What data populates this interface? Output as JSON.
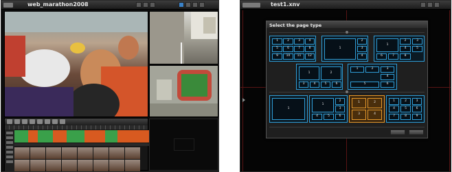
{
  "left_window": {
    "title": "web_marathon2008"
  },
  "right_window": {
    "title": "test1.xnv"
  },
  "dialog": {
    "title": "Select the page type",
    "layouts": [
      {
        "id": "grid-4x3",
        "cells": [
          "1",
          "2",
          "3",
          "4",
          "5",
          "6",
          "7",
          "8",
          "9",
          "10",
          "11",
          "12"
        ]
      },
      {
        "id": "big-1-plus-5",
        "cells": [
          "1",
          "2",
          "3",
          "4",
          "5",
          "6"
        ]
      },
      {
        "id": "big-2-plus-8",
        "cells": [
          "1",
          "2",
          "3",
          "4",
          "5",
          "6",
          "7",
          "8"
        ]
      },
      {
        "id": "two-big-plus-4",
        "cells": [
          "1",
          "2",
          "3",
          "4",
          "5",
          "6"
        ]
      },
      {
        "id": "mixed-6",
        "cells": [
          "1",
          "2",
          "3",
          "4",
          "5",
          "6"
        ]
      },
      {
        "id": "single",
        "cells": [
          "1"
        ]
      },
      {
        "id": "big-1-plus-5-b",
        "cells": [
          "1",
          "2",
          "3",
          "4",
          "5",
          "6"
        ]
      },
      {
        "id": "grid-2x2",
        "cells": [
          "1",
          "2",
          "3",
          "4"
        ],
        "selected": true
      },
      {
        "id": "grid-3x3",
        "cells": [
          "1",
          "2",
          "3",
          "4",
          "5",
          "6",
          "7",
          "8",
          "9"
        ]
      }
    ]
  },
  "colors": {
    "layout_border": "#2f9fd9",
    "selected_border": "#e89a2c",
    "bg_grid_line": "#5a1414"
  }
}
